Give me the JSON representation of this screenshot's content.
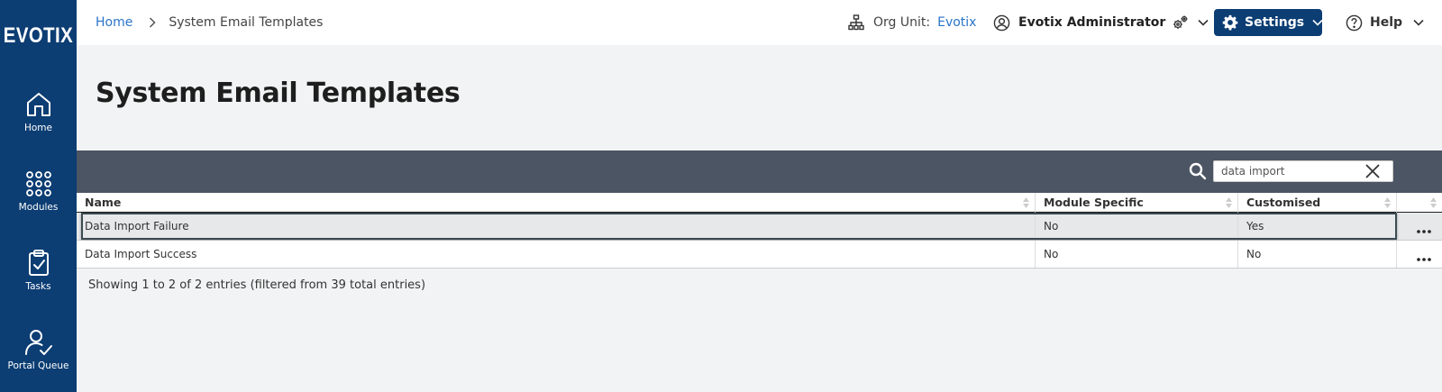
{
  "sidebar": {
    "logo": "EVOTIX",
    "items": [
      {
        "label": "Home",
        "icon": "home-icon"
      },
      {
        "label": "Modules",
        "icon": "grid-icon"
      },
      {
        "label": "Tasks",
        "icon": "clipboard-check-icon"
      },
      {
        "label": "Portal Queue",
        "icon": "user-check-icon"
      }
    ]
  },
  "header": {
    "breadcrumb": {
      "home": "Home",
      "current": "System Email Templates"
    },
    "org_unit": {
      "label": "Org Unit:",
      "value": "Evotix"
    },
    "user": {
      "name": "Evotix Administrator"
    },
    "settings_label": "Settings",
    "help_label": "Help"
  },
  "page": {
    "title": "System Email Templates"
  },
  "search": {
    "value": "data import"
  },
  "table": {
    "columns": [
      "Name",
      "Module Specific",
      "Customised"
    ],
    "rows": [
      {
        "name": "Data Import Failure",
        "module_specific": "No",
        "customised": "Yes",
        "highlighted": true
      },
      {
        "name": "Data Import Success",
        "module_specific": "No",
        "customised": "No",
        "highlighted": false
      }
    ],
    "info": "Showing 1 to 2 of 2 entries (filtered from 39 total entries)"
  },
  "colors": {
    "sidebar": "#0c3d73",
    "link": "#2a74c9",
    "toolbar": "#4b5563"
  }
}
